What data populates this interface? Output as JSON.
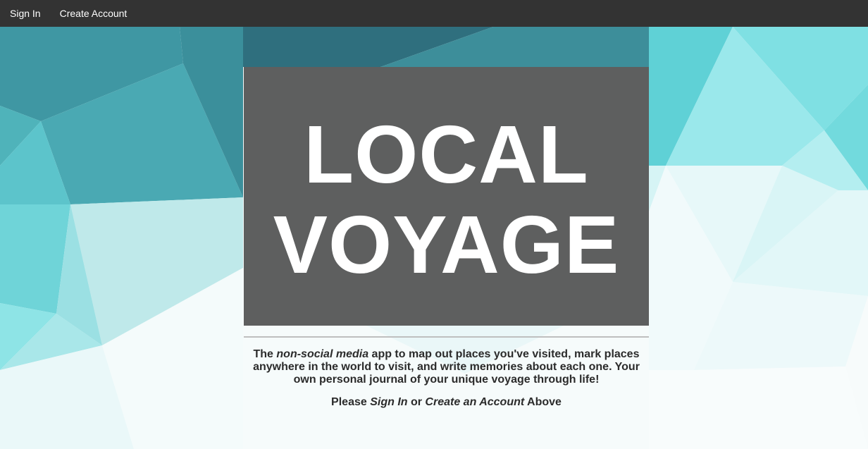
{
  "nav": {
    "sign_in": "Sign In",
    "create_account": "Create Account"
  },
  "hero": {
    "line1": "LOCAL",
    "line2": "VOYAGE"
  },
  "tagline": {
    "part1": "The ",
    "emphasis": "non-social media",
    "part2": " app to map out places you've visited, mark places anywhere in the world to visit, and write memories about each one. Your own personal journal of your unique voyage through life!"
  },
  "cta": {
    "prefix": "Please ",
    "sign_in": "Sign In",
    "middle": " or ",
    "create": "Create an Account",
    "suffix": " Above"
  },
  "colors": {
    "navbar": "#333333",
    "hero_overlay": "#404040",
    "text_dark": "#2b2b2b",
    "accent_teal": "#4cc6cc"
  }
}
